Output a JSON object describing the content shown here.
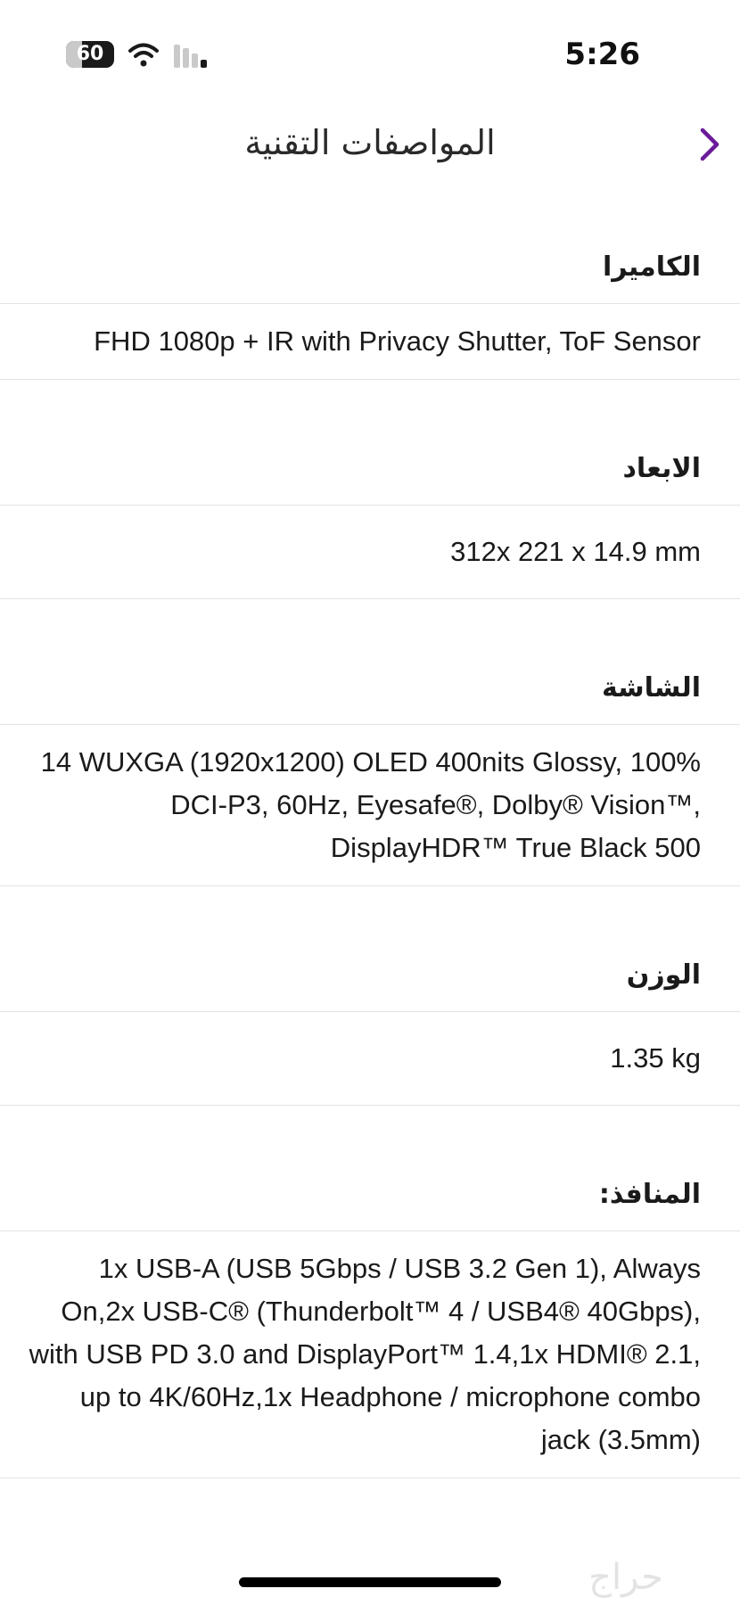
{
  "status_bar": {
    "battery_level": "60",
    "time": "5:26"
  },
  "header": {
    "title": "المواصفات التقنية"
  },
  "colors": {
    "accent": "#6a1b9a"
  },
  "specs": [
    {
      "label": "الكاميرا",
      "value": "FHD 1080p + IR with Privacy Shutter, ToF Sensor"
    },
    {
      "label": "الابعاد",
      "value": "312x 221 x 14.9 mm"
    },
    {
      "label": "الشاشة",
      "value": "14 WUXGA (1920x1200) OLED 400nits Glossy, 100% DCI-P3, 60Hz, Eyesafe®, Dolby® Vision™, DisplayHDR™ True Black 500"
    },
    {
      "label": "الوزن",
      "value": "1.35 kg"
    },
    {
      "label": "المنافذ:",
      "value": "1x USB-A (USB 5Gbps / USB 3.2 Gen 1), Always On,2x USB-C® (Thunderbolt™ 4 / USB4® 40Gbps), with USB PD 3.0 and DisplayPort™ 1.4,1x HDMI® 2.1, up to 4K/60Hz,1x Headphone / microphone combo jack (3.5mm)"
    }
  ],
  "watermark": {
    "text": "حراج"
  }
}
